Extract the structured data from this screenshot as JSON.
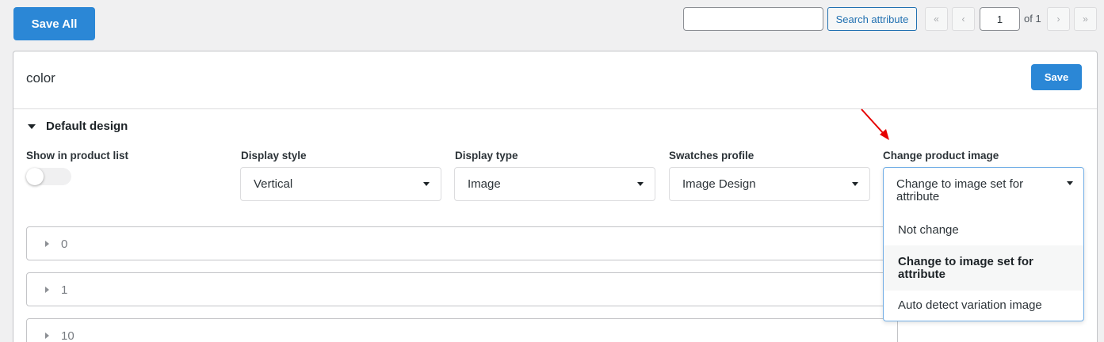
{
  "toolbar": {
    "save_all_label": "Save All",
    "search_value": "",
    "search_button_label": "Search attribute"
  },
  "pagination": {
    "first": "«",
    "prev": "‹",
    "current_page": "1",
    "of_label": "of 1",
    "next": "›",
    "last": "»"
  },
  "card": {
    "title": "color",
    "save_label": "Save",
    "section_label": "Default design"
  },
  "fields": {
    "show_in_list": {
      "label": "Show in product list",
      "enabled": false
    },
    "display_style": {
      "label": "Display style",
      "value": "Vertical"
    },
    "display_type": {
      "label": "Display type",
      "value": "Image"
    },
    "swatches_profile": {
      "label": "Swatches profile",
      "value": "Image Design"
    },
    "change_product_image": {
      "label": "Change product image",
      "value": "Change to image set for attribute",
      "options": [
        "Not change",
        "Change to image set for attribute",
        "Auto detect variation image"
      ],
      "highlighted_option": "Change to image set for attribute"
    }
  },
  "terms": [
    "0",
    "1",
    "10"
  ],
  "colors": {
    "primary": "#2b87d6",
    "link": "#2271b1",
    "annotation_arrow": "#e60000"
  }
}
